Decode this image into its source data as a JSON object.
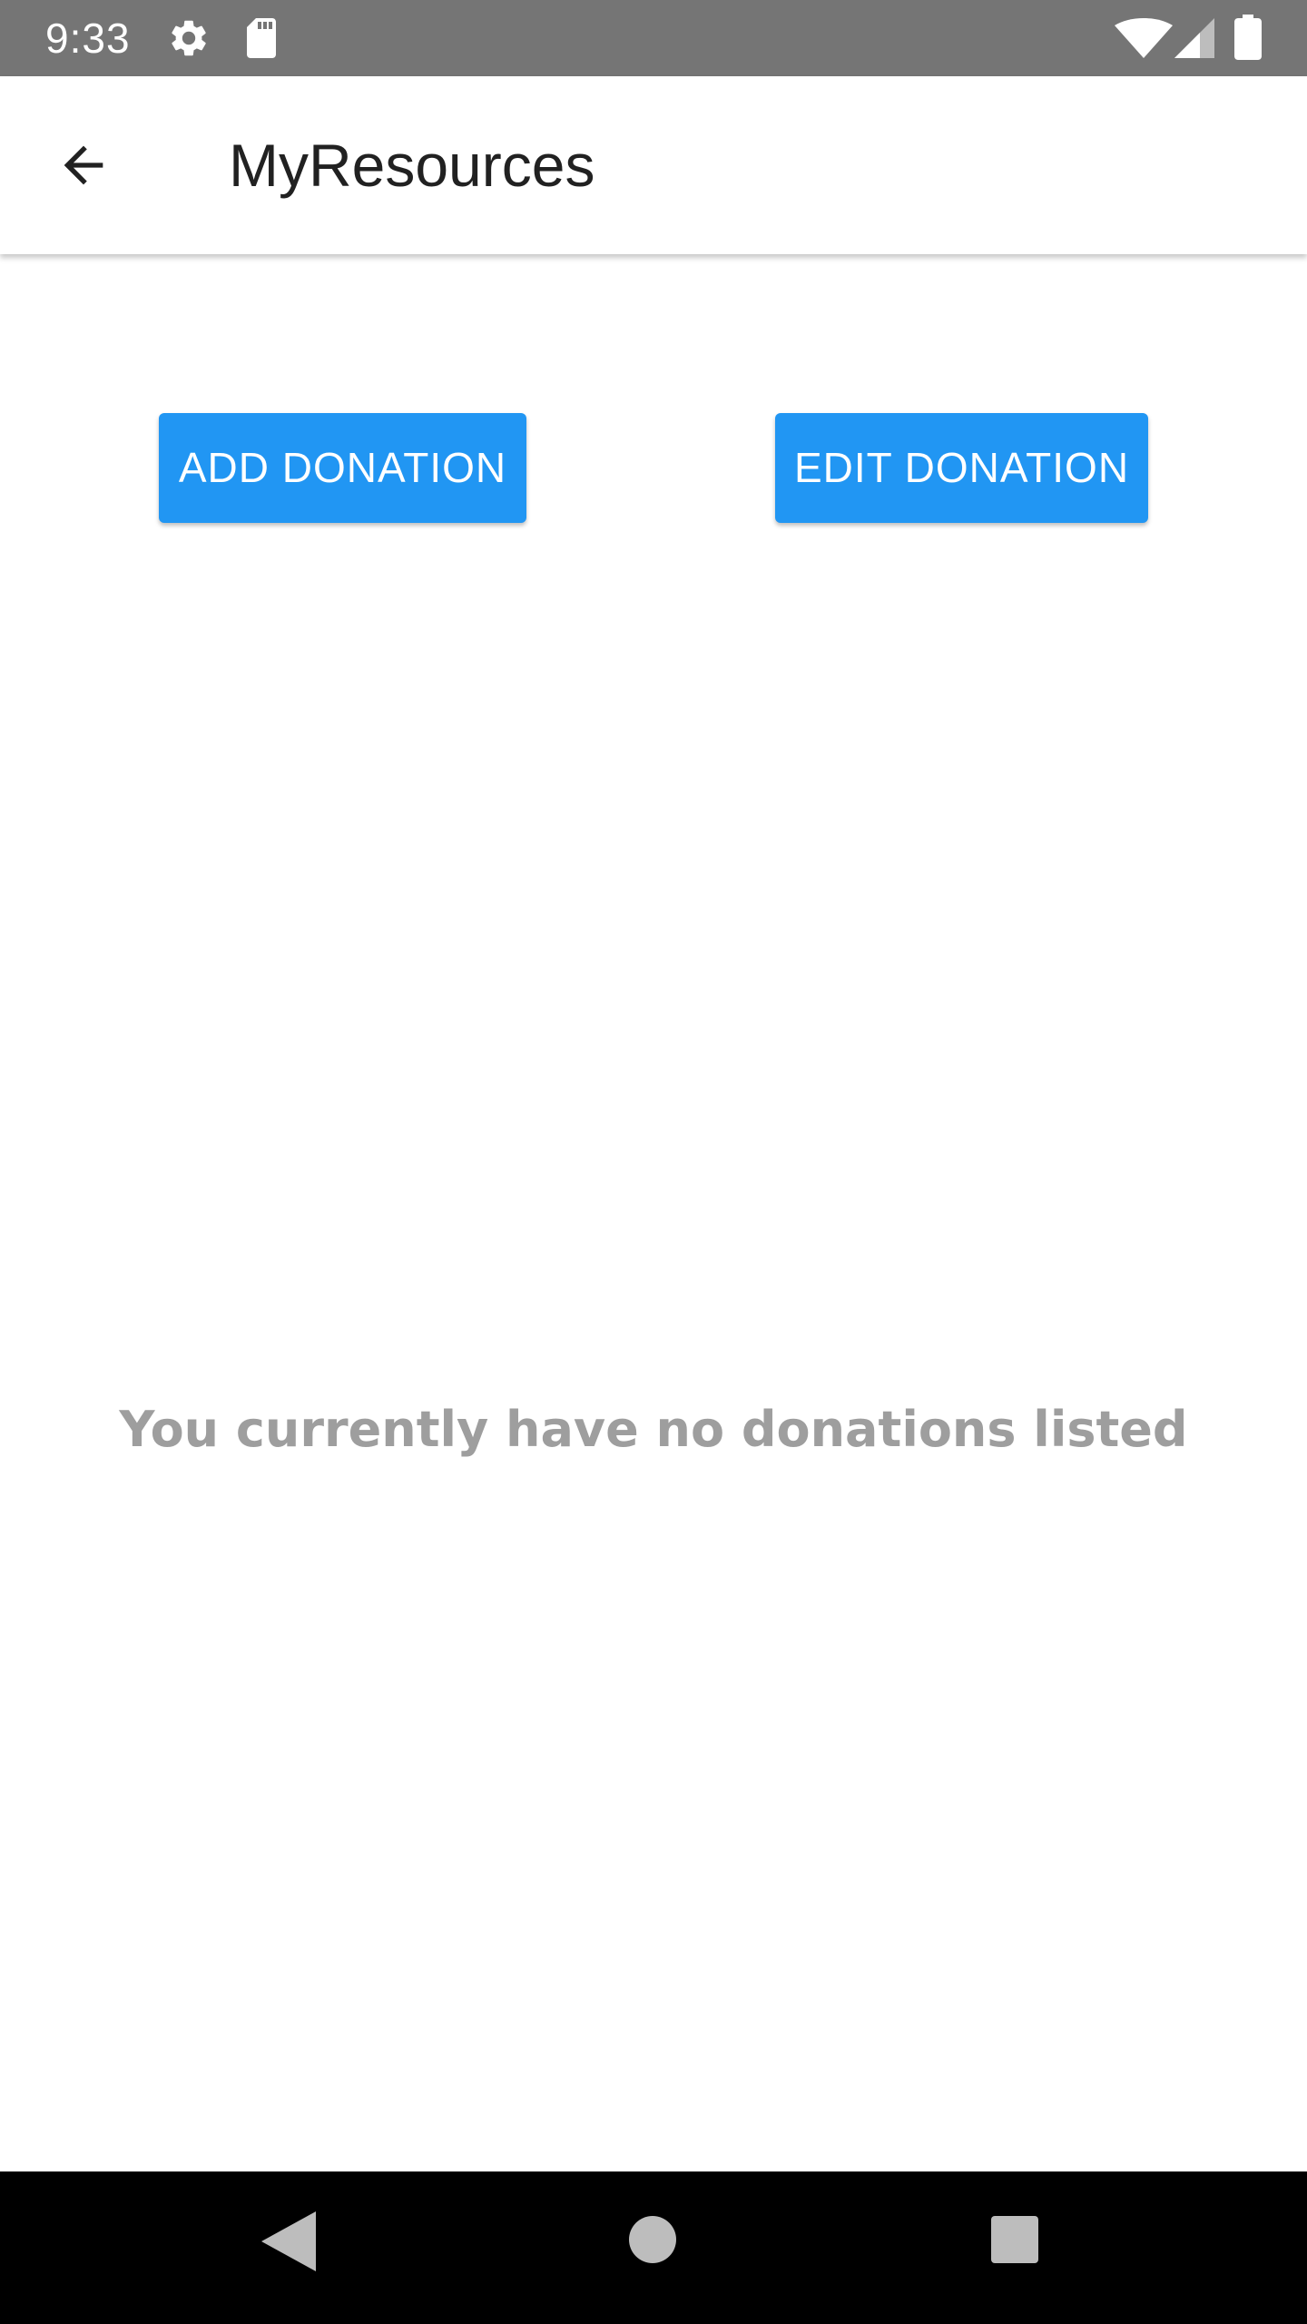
{
  "status_bar": {
    "time": "9:33",
    "icons": [
      "gear-icon",
      "sd-card-icon",
      "wifi-icon",
      "signal-icon",
      "battery-icon"
    ]
  },
  "app_bar": {
    "title": "MyResources",
    "back_icon": "arrow-back-icon"
  },
  "actions": {
    "add_label": "ADD DONATION",
    "edit_label": "EDIT DONATION"
  },
  "main": {
    "empty_message": "You currently have no donations listed"
  },
  "nav_bar": {
    "icons": [
      "nav-back-icon",
      "nav-home-icon",
      "nav-recents-icon"
    ]
  },
  "colors": {
    "accent": "#2196F3",
    "status_bar": "#757575",
    "empty_text": "#9E9E9E"
  }
}
